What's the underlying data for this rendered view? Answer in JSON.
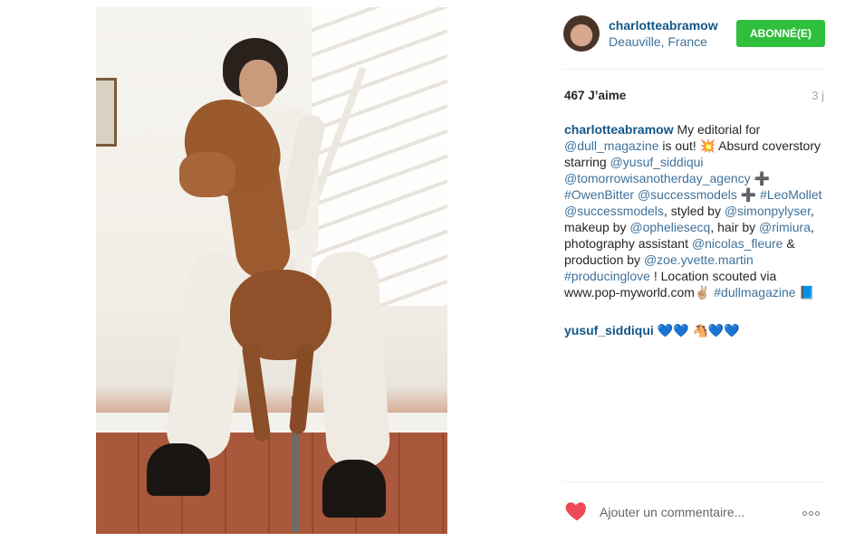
{
  "post": {
    "username": "charlotteabramow",
    "location": "Deauville, France",
    "follow_label": "ABONNÉ(E)",
    "likes": "467 J’aime",
    "time_ago": "3 j"
  },
  "caption": {
    "author": "charlotteabramow",
    "t1": " My editorial for ",
    "m_dull": "@dull_magazine",
    "t2": " is out! 💥 Absurd coverstory starring ",
    "m_yusuf": "@yusuf_siddiqui",
    "t3": " ",
    "m_tomorrow": "@tomorrowisanotherday_agency",
    "t4": " ➕ ",
    "h_owen": "#OwenBitter",
    "t5": " ",
    "m_success1": "@successmodels",
    "t6": " ➕ ",
    "h_leo": "#LeoMollet",
    "t7": " ",
    "m_success2": "@successmodels",
    "t8": ", styled by ",
    "m_simon": "@simonpylyser",
    "t9": ", makeup by ",
    "m_ophelie": "@opheliesecq",
    "t10": ", hair by ",
    "m_rimi": "@rimiura",
    "t11": ", photography assistant ",
    "m_nicolas": "@nicolas_fleure",
    "t12": " & production by ",
    "m_zoe": "@zoe.yvette.martin",
    "t13": " ",
    "h_producing": "#producinglove",
    "t14": " ! Location scouted via www.pop-myworld.com✌🏼 ",
    "h_dull": "#dullmagazine",
    "t15": " 📘"
  },
  "comment": {
    "author": "yusuf_siddiqui",
    "text": " 💙💙 🐴💙💙"
  },
  "footer": {
    "comment_placeholder": "Ajouter un commentaire..."
  },
  "colors": {
    "follow_button": "#2fbf3c",
    "username": "#125688",
    "link": "#3f729b",
    "like_heart": "#ed4956"
  },
  "icons": {
    "like": "heart-icon",
    "more": "more-options-icon"
  }
}
